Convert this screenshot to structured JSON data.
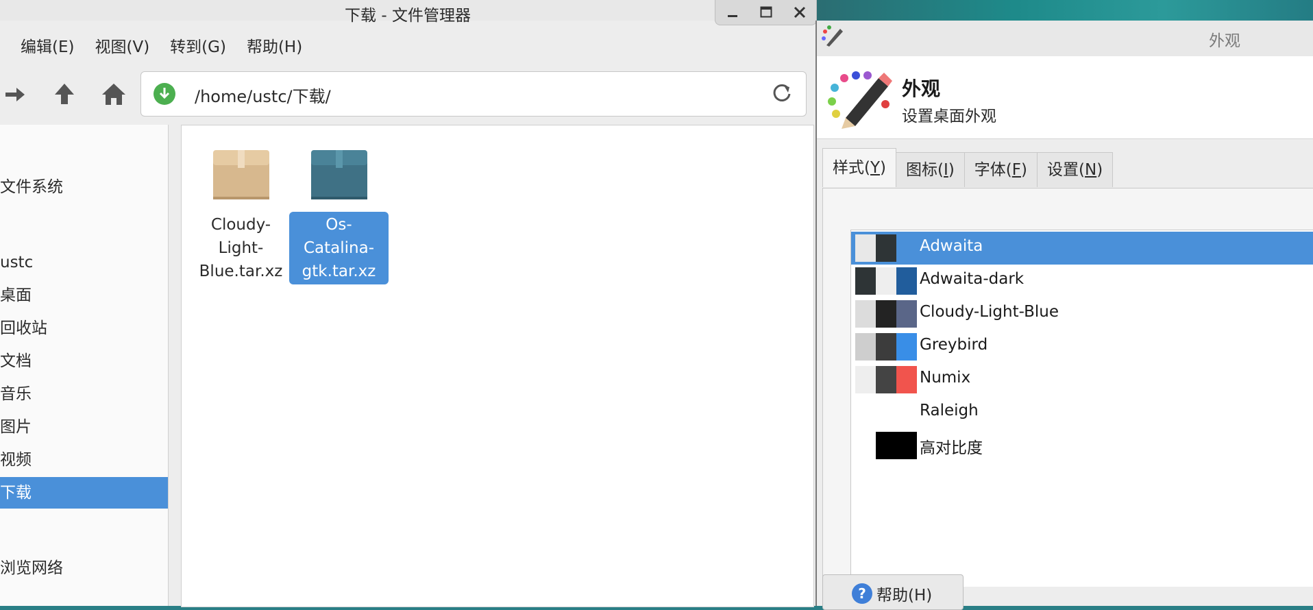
{
  "file_manager": {
    "title": "下载 - 文件管理器",
    "menu": [
      "编辑(E)",
      "视图(V)",
      "转到(G)",
      "帮助(H)"
    ],
    "address": "/home/ustc/下载/",
    "sidebar": [
      "文件系统",
      "ustc",
      "桌面",
      "回收站",
      "文档",
      "音乐",
      "图片",
      "视频",
      "下载",
      "浏览网络"
    ],
    "selected_sidebar": "下载",
    "files": [
      {
        "name": "Cloudy-Light-Blue.tar.xz",
        "line1": "Cloudy-Light-",
        "line2": "Blue.tar.xz",
        "icon": "package-beige-icon",
        "selected": false
      },
      {
        "name": "Os-Catalina-gtk.tar.xz",
        "line1": "Os-Catalina-",
        "line2": "gtk.tar.xz",
        "icon": "package-teal-icon",
        "selected": true
      }
    ]
  },
  "appearance": {
    "window_title": "外观",
    "header_title": "外观",
    "header_subtitle": "设置桌面外观",
    "tabs": [
      {
        "label": "样式(",
        "key": "Y",
        "suffix": ")"
      },
      {
        "label": "图标(",
        "key": "I",
        "suffix": ")"
      },
      {
        "label": "字体(",
        "key": "F",
        "suffix": ")"
      },
      {
        "label": "设置(",
        "key": "N",
        "suffix": ")"
      }
    ],
    "themes": [
      {
        "name": "Adwaita",
        "colors": [
          "#e8e8e8",
          "#2e3436",
          "#4a90d9"
        ]
      },
      {
        "name": "Adwaita-dark",
        "colors": [
          "#2e3436",
          "#eeeeee",
          "#215d9c"
        ]
      },
      {
        "name": "Cloudy-Light-Blue",
        "colors": [
          "#dcdcdc",
          "#232323",
          "#5a6688"
        ]
      },
      {
        "name": "Greybird",
        "colors": [
          "#cecece",
          "#3c3c3c",
          "#398ee7"
        ]
      },
      {
        "name": "Numix",
        "colors": [
          "#eeeeee",
          "#444444",
          "#f1544d"
        ]
      },
      {
        "name": "Raleigh",
        "colors": [
          "#ffffff",
          "#ffffff",
          "#ffffff"
        ]
      },
      {
        "name": "高对比度",
        "colors": [
          "#ffffff",
          "#000000",
          "#000000"
        ]
      }
    ],
    "selected_theme": "Adwaita",
    "help_button": "帮助(H)"
  }
}
